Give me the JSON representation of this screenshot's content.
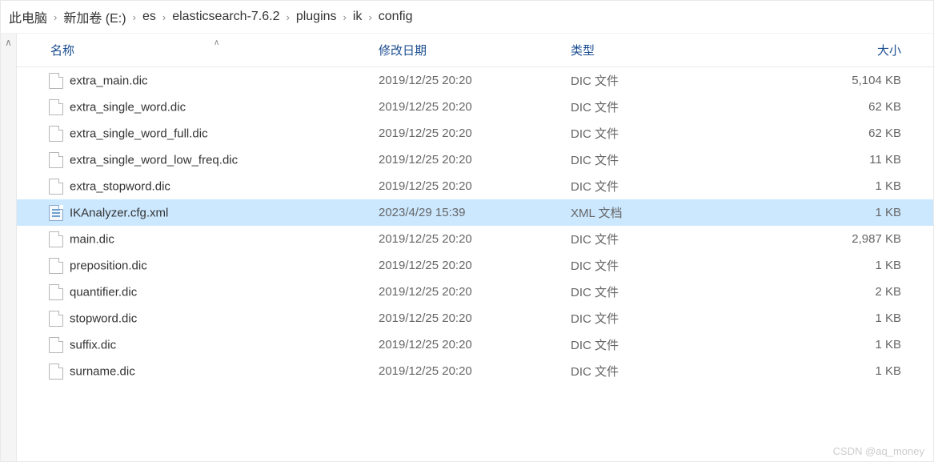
{
  "breadcrumb": [
    {
      "label": "此电脑"
    },
    {
      "label": "新加卷 (E:)"
    },
    {
      "label": "es"
    },
    {
      "label": "elasticsearch-7.6.2"
    },
    {
      "label": "plugins"
    },
    {
      "label": "ik"
    },
    {
      "label": "config"
    }
  ],
  "columns": {
    "name": "名称",
    "date": "修改日期",
    "type": "类型",
    "size": "大小"
  },
  "files": [
    {
      "name": "extra_main.dic",
      "date": "2019/12/25 20:20",
      "type": "DIC 文件",
      "size": "5,104 KB",
      "icon": "plain",
      "selected": false
    },
    {
      "name": "extra_single_word.dic",
      "date": "2019/12/25 20:20",
      "type": "DIC 文件",
      "size": "62 KB",
      "icon": "plain",
      "selected": false
    },
    {
      "name": "extra_single_word_full.dic",
      "date": "2019/12/25 20:20",
      "type": "DIC 文件",
      "size": "62 KB",
      "icon": "plain",
      "selected": false
    },
    {
      "name": "extra_single_word_low_freq.dic",
      "date": "2019/12/25 20:20",
      "type": "DIC 文件",
      "size": "11 KB",
      "icon": "plain",
      "selected": false
    },
    {
      "name": "extra_stopword.dic",
      "date": "2019/12/25 20:20",
      "type": "DIC 文件",
      "size": "1 KB",
      "icon": "plain",
      "selected": false
    },
    {
      "name": "IKAnalyzer.cfg.xml",
      "date": "2023/4/29 15:39",
      "type": "XML 文档",
      "size": "1 KB",
      "icon": "xml",
      "selected": true
    },
    {
      "name": "main.dic",
      "date": "2019/12/25 20:20",
      "type": "DIC 文件",
      "size": "2,987 KB",
      "icon": "plain",
      "selected": false
    },
    {
      "name": "preposition.dic",
      "date": "2019/12/25 20:20",
      "type": "DIC 文件",
      "size": "1 KB",
      "icon": "plain",
      "selected": false
    },
    {
      "name": "quantifier.dic",
      "date": "2019/12/25 20:20",
      "type": "DIC 文件",
      "size": "2 KB",
      "icon": "plain",
      "selected": false
    },
    {
      "name": "stopword.dic",
      "date": "2019/12/25 20:20",
      "type": "DIC 文件",
      "size": "1 KB",
      "icon": "plain",
      "selected": false
    },
    {
      "name": "suffix.dic",
      "date": "2019/12/25 20:20",
      "type": "DIC 文件",
      "size": "1 KB",
      "icon": "plain",
      "selected": false
    },
    {
      "name": "surname.dic",
      "date": "2019/12/25 20:20",
      "type": "DIC 文件",
      "size": "1 KB",
      "icon": "plain",
      "selected": false
    }
  ],
  "watermark": "CSDN @aq_money"
}
